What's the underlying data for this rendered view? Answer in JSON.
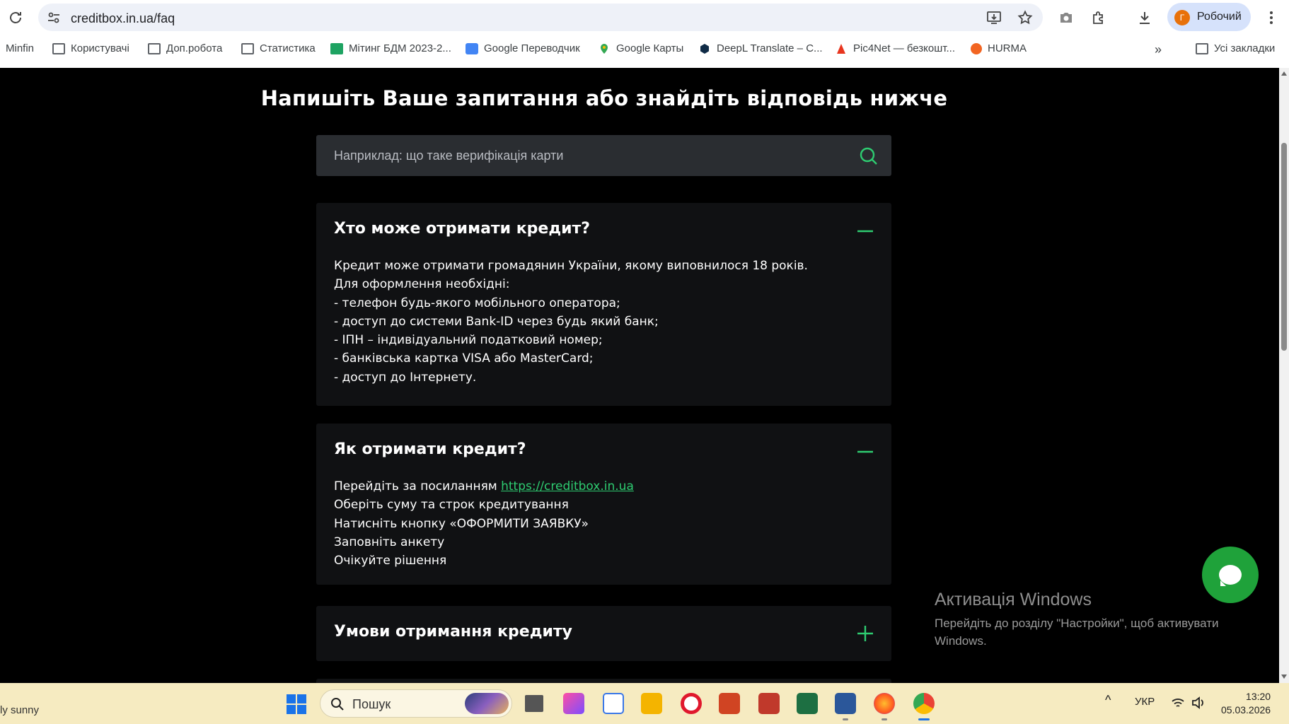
{
  "browser": {
    "url": "creditbox.in.ua/faq",
    "profile_initial": "Г",
    "profile_name": "Робочий",
    "bookmarks": [
      {
        "label": "Minfin",
        "icon": "none"
      },
      {
        "label": "Користувачі",
        "icon": "folder-icon"
      },
      {
        "label": "Доп.робота",
        "icon": "folder-icon"
      },
      {
        "label": "Статистика",
        "icon": "folder-icon"
      },
      {
        "label": "Мітинг БДМ 2023-2...",
        "icon": "sheets-icon"
      },
      {
        "label": "Google Переводчик",
        "icon": "translate-icon"
      },
      {
        "label": "Google Карты",
        "icon": "maps-pin-icon"
      },
      {
        "label": "DeepL Translate – C...",
        "icon": "deepl-icon"
      },
      {
        "label": "Pic4Net — безкошт...",
        "icon": "pic4net-icon"
      },
      {
        "label": "HURMA",
        "icon": "hurma-icon"
      }
    ],
    "all_bookmarks_label": "Усі закладки"
  },
  "page": {
    "title": "Напишіть Ваше запитання або знайдіть відповідь нижче",
    "search": {
      "placeholder": "Наприклад: що таке верифікація карти",
      "value": ""
    },
    "faq": [
      {
        "question": "Хто може отримати кредит?",
        "expanded": true,
        "answer": [
          "Кредит може отримати громадянин України, якому виповнилося 18 років.",
          "Для оформлення необхідні:",
          "- телефон будь-якого мобільного оператора;",
          "- доступ до системи Bank-ID через будь який банк;",
          "- ІПН – індивідуальний податковий номер;",
          "- банківська картка VISA або MasterCard;",
          "- доступ до Інтернету."
        ]
      },
      {
        "question": "Як отримати кредит?",
        "expanded": true,
        "answer_link_prefix": "Перейдіть за посиланням ",
        "answer_link": "https://creditbox.in.ua",
        "answer": [
          "Оберіть суму та строк кредитування",
          "Натисніть кнопку «ОФОРМИТИ ЗАЯВКУ»",
          "Заповніть анкету",
          "Очікуйте рішення"
        ]
      },
      {
        "question": "Умови отримання кредиту",
        "expanded": false
      }
    ],
    "accent_color": "#2ecc71"
  },
  "windows": {
    "activation_title": "Активація Windows",
    "activation_text": "Перейдіть до розділу \"Настройки\", щоб активувати Windows.",
    "weather": "ly sunny",
    "search_label": "Пошук",
    "language": "УКР",
    "time": "13:20",
    "date": "05.03.2026"
  }
}
